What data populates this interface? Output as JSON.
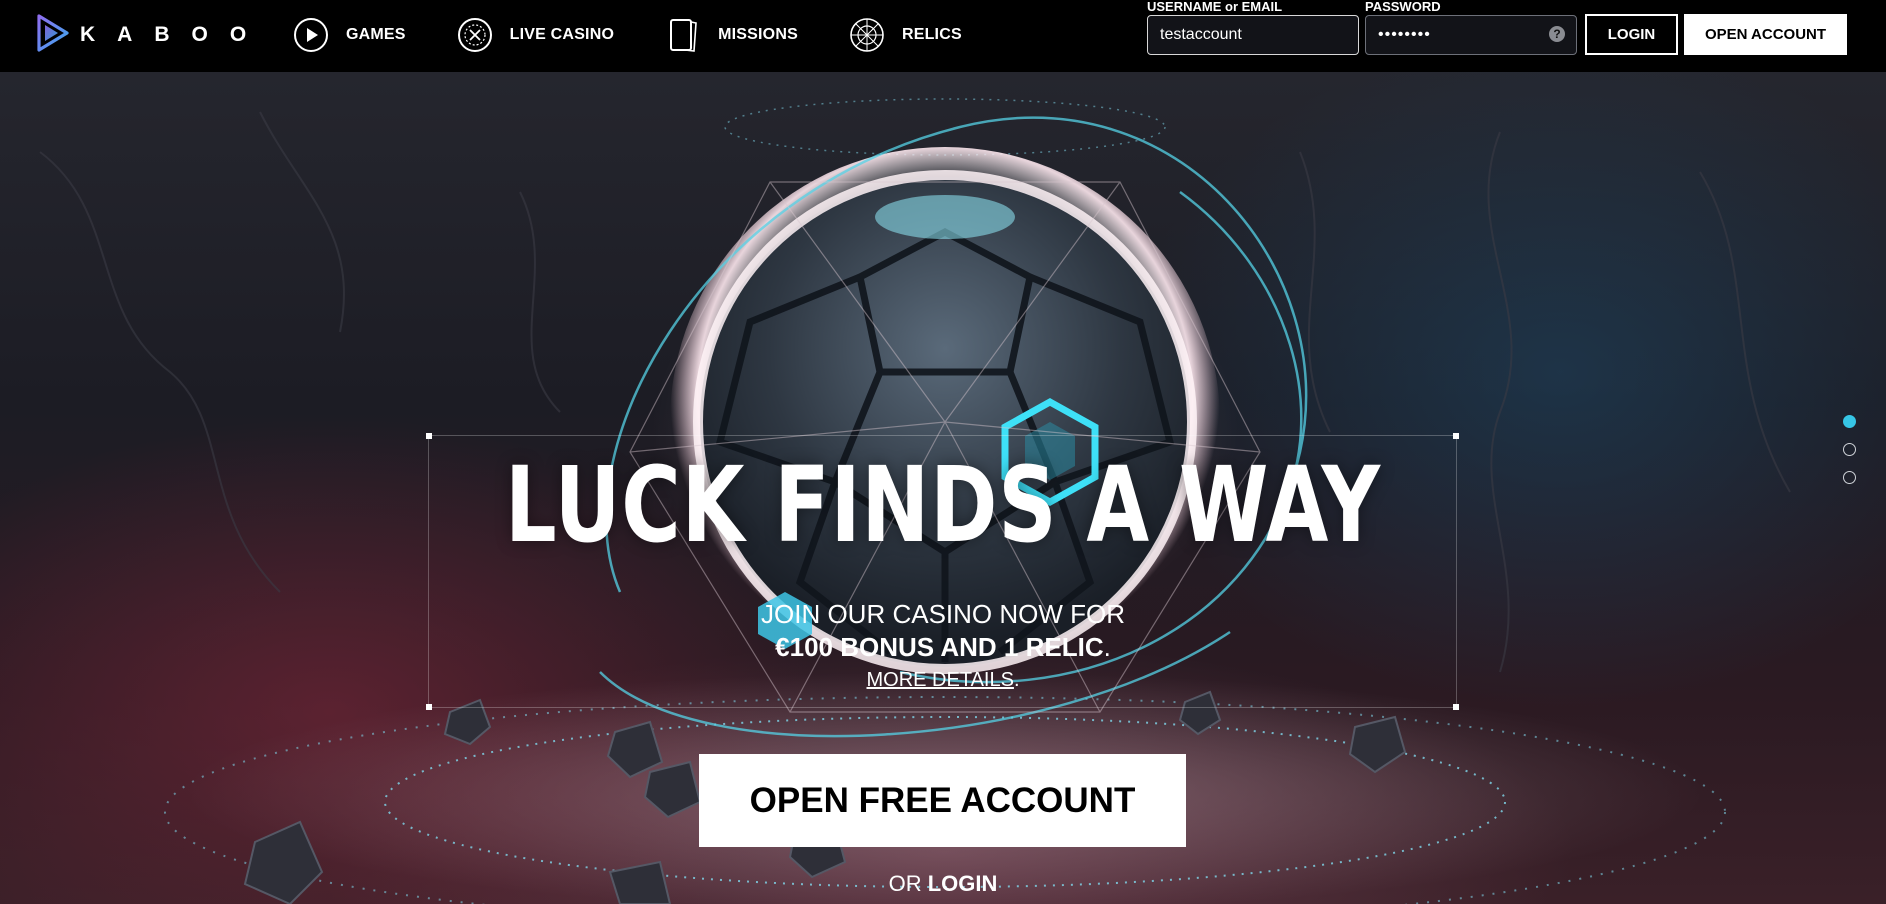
{
  "brand": {
    "name": "KABOO",
    "logo_icon": "kaboo-play-logo-icon"
  },
  "nav": {
    "items": [
      {
        "label": "GAMES",
        "icon": "play-circle-icon"
      },
      {
        "label": "LIVE CASINO",
        "icon": "roulette-icon"
      },
      {
        "label": "MISSIONS",
        "icon": "cards-icon"
      },
      {
        "label": "RELICS",
        "icon": "relic-sphere-icon"
      }
    ]
  },
  "login_form": {
    "username_label": "USERNAME or EMAIL",
    "username_value": "testaccount",
    "password_label": "PASSWORD",
    "password_value": "••••••••",
    "help_glyph": "?",
    "login_label": "LOGIN",
    "open_account_label": "OPEN ACCOUNT"
  },
  "hero": {
    "headline": "LUCK FINDS A WAY",
    "subline": "JOIN OUR CASINO NOW FOR",
    "offer": "€100 BONUS AND 1 RELIC",
    "offer_suffix": ".",
    "more_details": "MORE DETAILS",
    "more_details_suffix": ".",
    "cta": "OPEN FREE ACCOUNT",
    "or_text": "OR",
    "or_login": "LOGIN"
  },
  "carousel": {
    "slide_count": 3,
    "active_index": 0
  },
  "colors": {
    "accent": "#36c6e6",
    "logo_blue": "#4f7fe6",
    "header_bg": "#000000",
    "cta_bg": "#ffffff"
  }
}
